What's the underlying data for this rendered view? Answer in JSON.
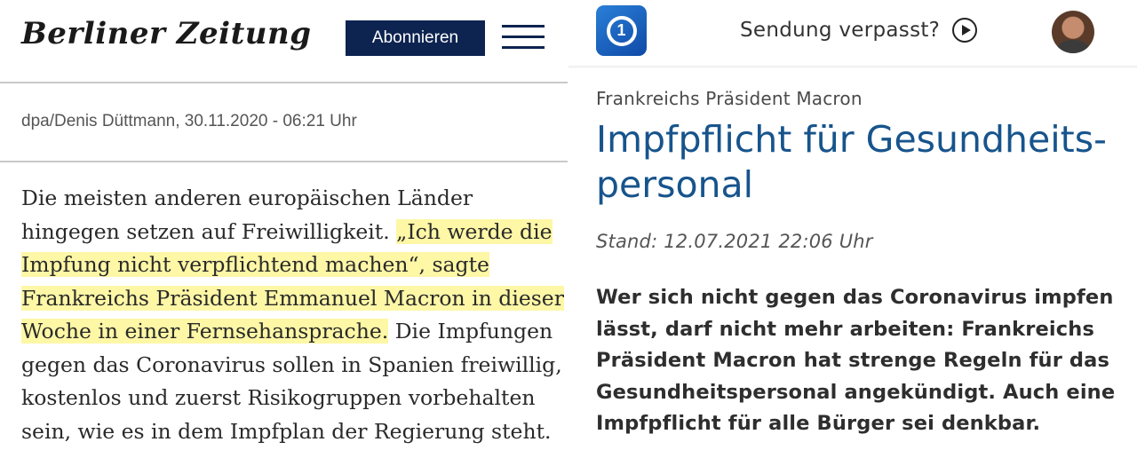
{
  "berliner_zeitung": {
    "logo_text": "Berliner Zeitung",
    "subscribe_label": "Abonnieren",
    "photo_credit": "dpa/Denis Düttmann, 30.11.2020 - 06:21 Uhr",
    "article_lines": [
      {
        "before": "Die meisten anderen europäischen Länder",
        "highlight": "",
        "after": ""
      },
      {
        "before": "hingegen setzen auf Freiwilligkeit. ",
        "highlight": "„Ich werde die",
        "after": ""
      },
      {
        "before": "",
        "highlight": "Impfung nicht verpflichtend machen“, sagte",
        "after": ""
      },
      {
        "before": "",
        "highlight": "Frankreichs Präsident Emmanuel Macron in dieser",
        "after": ""
      },
      {
        "before": "",
        "highlight": "Woche in einer Fernsehansprache.",
        "after": " Die Impfungen"
      },
      {
        "before": "gegen das Coronavirus sollen in Spanien freiwillig,",
        "highlight": "",
        "after": ""
      },
      {
        "before": "kostenlos und zuerst Risikogruppen vorbehalten",
        "highlight": "",
        "after": ""
      },
      {
        "before": "sein, wie es in dem Impfplan der Regierung steht.",
        "highlight": "",
        "after": ""
      }
    ],
    "colors": {
      "button_bg": "#0d2350",
      "highlight": "#fdf7a6"
    }
  },
  "tagesschau": {
    "logo_glyph": "1",
    "missed_label": "Sendung verpasst?",
    "topline": "Frankreichs Präsident Macron",
    "headline_lines": [
      "Impfpflicht für Gesundheits-",
      "personal"
    ],
    "stand": "Stand: 12.07.2021 22:06 Uhr",
    "lead_lines": [
      "Wer sich nicht gegen das Coronavirus impfen",
      "lässt, darf nicht mehr arbeiten: Frankreichs",
      "Präsident Macron hat strenge Regeln für das",
      "Gesundheitspersonal angekündigt. Auch eine",
      "Impfpflicht für alle Bürger sei denkbar."
    ],
    "colors": {
      "headline": "#17548c",
      "logo": "#1d63c2"
    },
    "icons": {
      "play": "play-circle-icon",
      "avatar": "user-avatar"
    }
  }
}
